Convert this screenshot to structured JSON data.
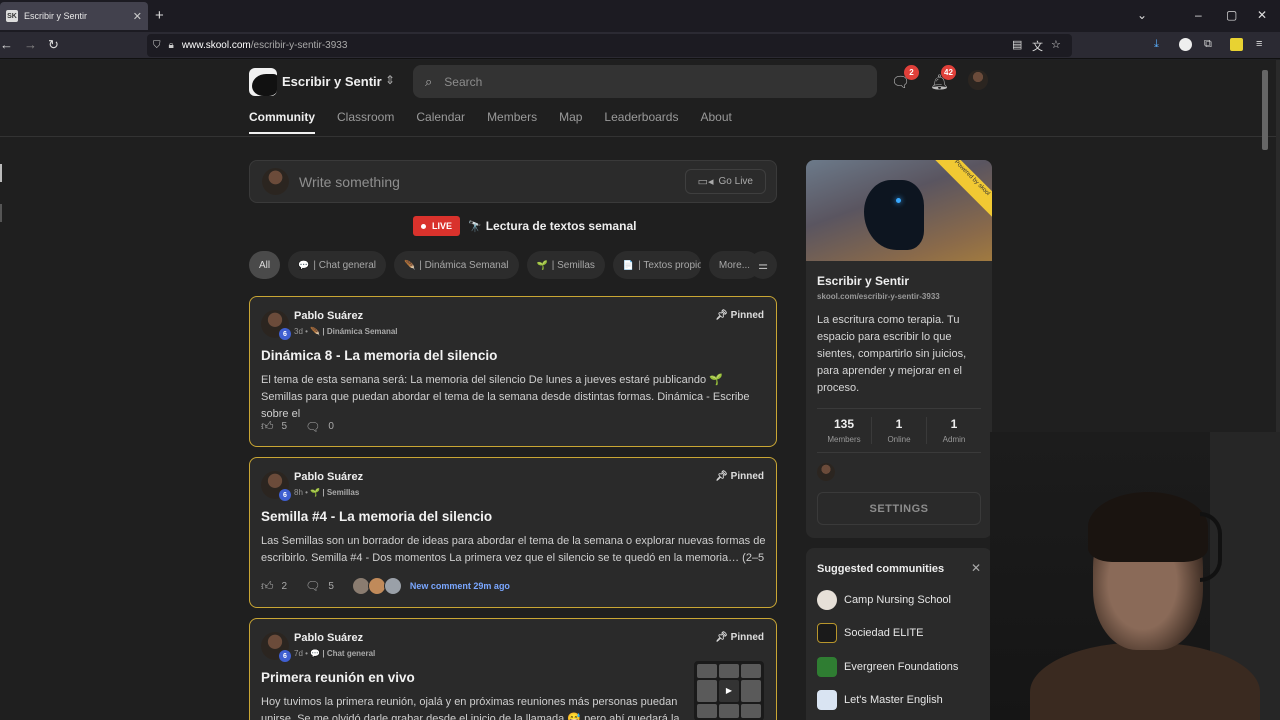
{
  "browser": {
    "tab_title": "Escribir y Sentir",
    "tab_favicon": "SK",
    "url_host": "www.skool.com",
    "url_path": "/escribir-y-sentir-3933"
  },
  "header": {
    "community_name": "Escribir y Sentir",
    "search_placeholder": "Search",
    "chat_badge": "2",
    "notif_badge": "42"
  },
  "nav": {
    "tabs": [
      "Community",
      "Classroom",
      "Calendar",
      "Members",
      "Map",
      "Leaderboards",
      "About"
    ]
  },
  "composer": {
    "placeholder": "Write something",
    "go_live": "Go Live"
  },
  "live": {
    "badge": "LIVE",
    "emoji": "🔭",
    "title": "Lectura de textos semanal"
  },
  "filters": {
    "chips": [
      {
        "emoji": "",
        "label": "All"
      },
      {
        "emoji": "💬",
        "label": "| Chat general"
      },
      {
        "emoji": "🪶",
        "label": "| Dinámica Semanal"
      },
      {
        "emoji": "🌱",
        "label": "| Semillas"
      },
      {
        "emoji": "📄",
        "label": "| Textos propio"
      },
      {
        "emoji": "",
        "label": "More..."
      }
    ]
  },
  "posts": [
    {
      "author": "Pablo Suárez",
      "level": "6",
      "time": "3d",
      "cat_emoji": "🪶",
      "category": "| Dinámica Semanal",
      "pinned": "Pinned",
      "title": "Dinámica 8 - La memoria del silencio",
      "body": "El tema de esta semana será: La memoria del silencio De lunes a jueves estaré publicando 🌱 Semillas para que puedan abordar el tema de la semana desde distintas formas. Dinámica - Escribe sobre el",
      "likes": "5",
      "comments": "0"
    },
    {
      "author": "Pablo Suárez",
      "level": "6",
      "time": "8h",
      "cat_emoji": "🌱",
      "category": "| Semillas",
      "pinned": "Pinned",
      "title": "Semilla #4 - La memoria del silencio",
      "body": "Las Semillas son un borrador de ideas para abordar el tema de la semana o explorar nuevas formas de escribirlo. Semilla #4 - Dos momentos La primera vez que el silencio se te quedó en la memoria… (2–5",
      "likes": "2",
      "comments": "5",
      "new_comment": "New comment 29m ago"
    },
    {
      "author": "Pablo Suárez",
      "level": "6",
      "time": "7d",
      "cat_emoji": "💬",
      "category": "| Chat general",
      "pinned": "Pinned",
      "title": "Primera reunión en vivo",
      "body": "Hoy tuvimos la primera reunión, ojalá y en próximas reuniones más personas puedan unirse. Se me olvidó darle grabar desde el inicio de la llamada 😅 pero ahí quedará la"
    }
  ],
  "about": {
    "name": "Escribir y Sentir",
    "url": "skool.com/escribir-y-sentir-3933",
    "ribbon": "Powered by skool",
    "description": "La escritura como terapia. Tu espacio para escribir lo que sientes, compartirlo sin juicios, para aprender y mejorar en el proceso.",
    "stats": [
      {
        "n": "135",
        "l": "Members"
      },
      {
        "n": "1",
        "l": "Online"
      },
      {
        "n": "1",
        "l": "Admin"
      }
    ],
    "settings": "SETTINGS"
  },
  "suggested": {
    "heading": "Suggested communities",
    "items": [
      {
        "name": "Camp Nursing School",
        "color": "#e6e0d8"
      },
      {
        "name": "Sociedad ELITE",
        "color": "#1a1a1a"
      },
      {
        "name": "Evergreen Foundations",
        "color": "#2f7d32"
      },
      {
        "name": "Let's Master English",
        "color": "#d9e4f2"
      }
    ]
  }
}
